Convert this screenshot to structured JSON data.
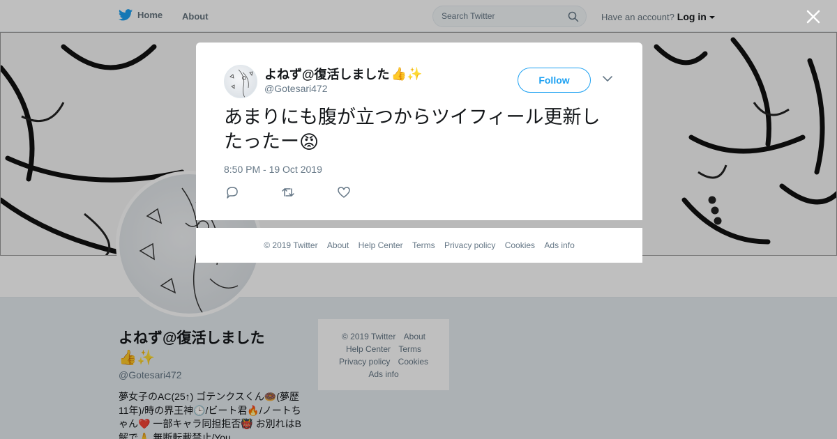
{
  "topbar": {
    "home_label": "Home",
    "about_label": "About",
    "search_placeholder": "Search Twitter",
    "account_prompt": "Have an account?",
    "login_label": "Log in"
  },
  "profile": {
    "name": "よねず@復活しました👍✨",
    "handle": "@Gotesari472",
    "bio": "夢女子のAC(25↑) ゴテンクスくん🍩(夢歴11年)/時の界王神🕒/ビート君🔥/ノートちゃん❤️ 一部キャラ同担拒否👹 お別れはB解で🙏 無断転載禁止/You"
  },
  "side_footer": {
    "links": [
      "© 2019 Twitter",
      "About",
      "Help Center",
      "Terms",
      "Privacy policy",
      "Cookies",
      "Ads info"
    ]
  },
  "modal": {
    "name": "よねず@復活しました",
    "name_emoji": "👍✨",
    "handle": "@Gotesari472",
    "follow_label": "Follow",
    "tweet_text": "あまりにも腹が立つからツイフィール更新したったー",
    "tweet_emoji": "😡",
    "timestamp": "8:50 PM - 19 Oct 2019"
  },
  "modal_footer": {
    "links": [
      "© 2019 Twitter",
      "About",
      "Help Center",
      "Terms",
      "Privacy policy",
      "Cookies",
      "Ads info"
    ]
  },
  "icons": {
    "brand": "twitter-bird-icon",
    "search": "search-icon",
    "close": "close-icon",
    "chevron": "chevron-down-icon",
    "reply": "reply-icon",
    "retweet": "retweet-icon",
    "like": "heart-icon"
  },
  "colors": {
    "brand": "#1da1f2",
    "text": "#14171a",
    "muted": "#657786"
  }
}
